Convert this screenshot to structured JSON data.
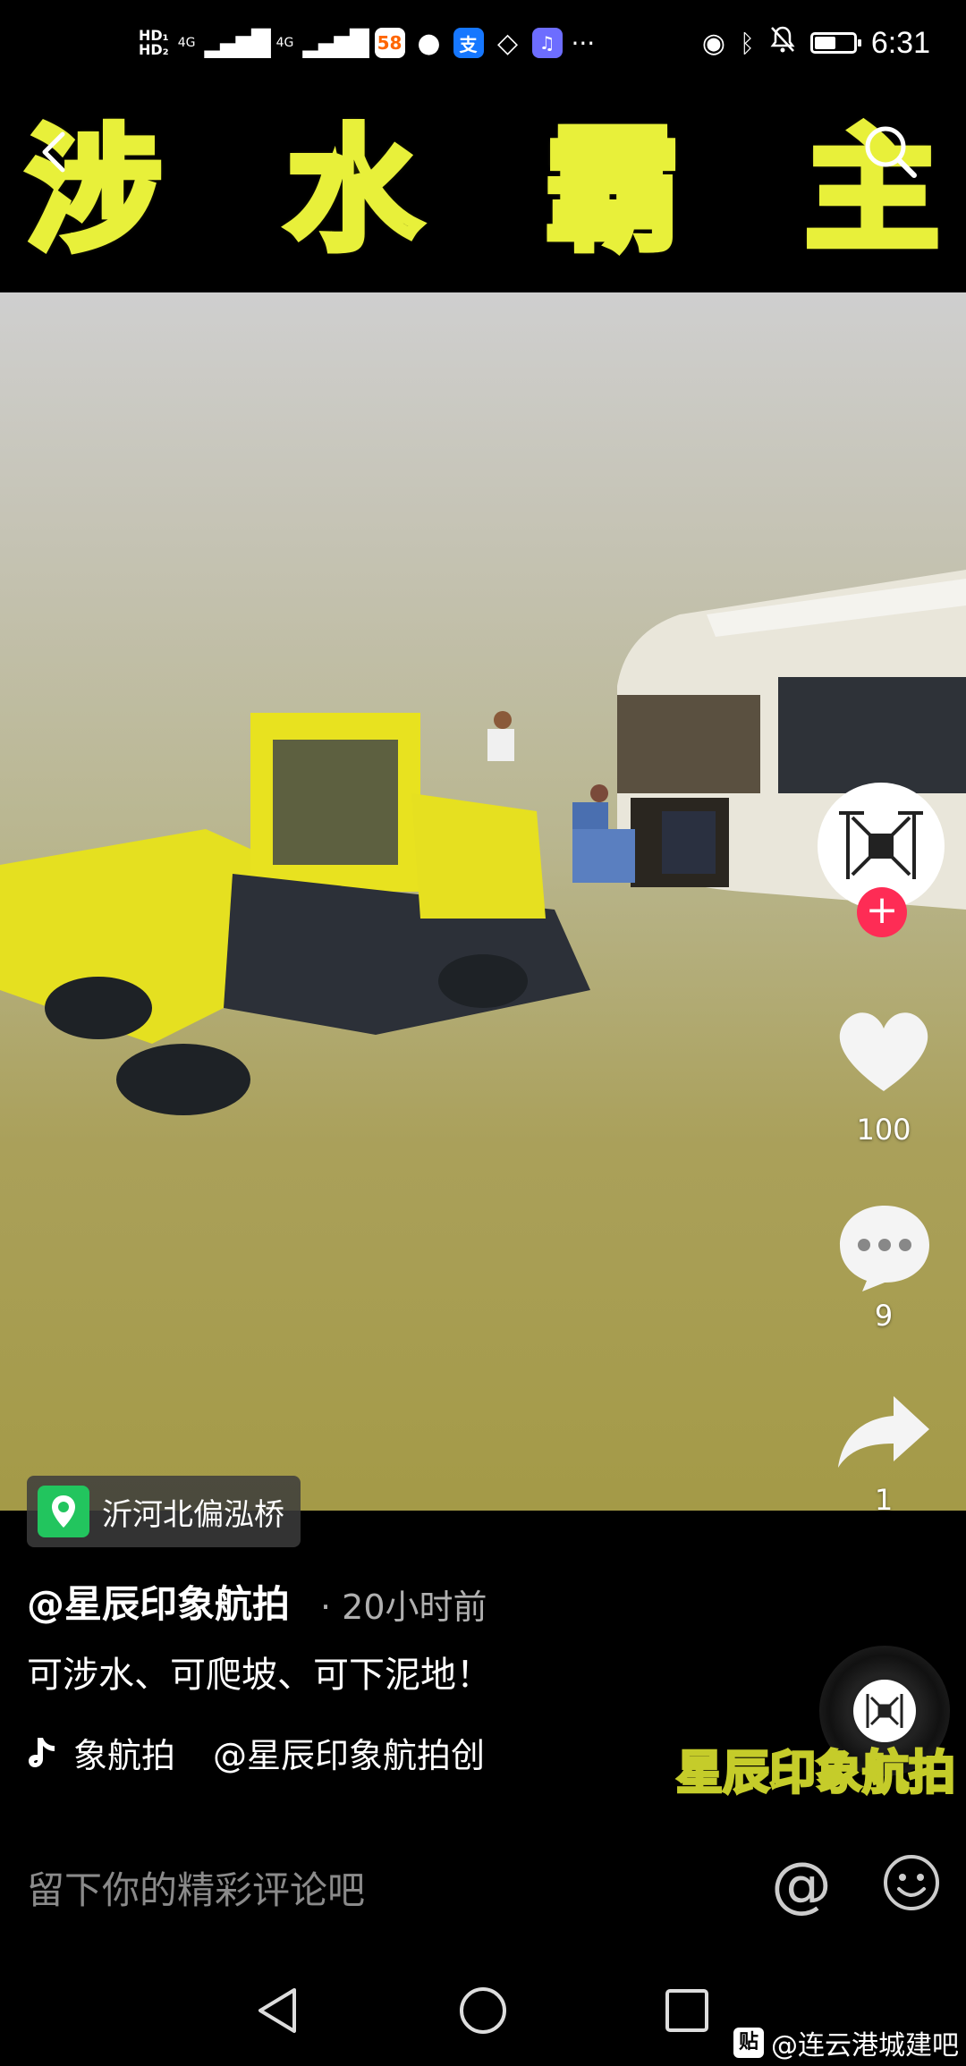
{
  "status_bar": {
    "sim1": "HD₁",
    "sim2": "HD₂",
    "net1": "4G",
    "net2": "4G",
    "app1_label": "58",
    "app3_label": "支",
    "more": "···",
    "time": "6:31",
    "battery_level": 0.55
  },
  "banner": {
    "title_chars": [
      "涉",
      "水",
      "霸",
      "主"
    ]
  },
  "rail": {
    "like_count": "100",
    "comment_count": "9",
    "share_count": "1"
  },
  "location": {
    "name": "沂河北偏泓桥"
  },
  "post": {
    "author": "@星辰印象航拍",
    "time_ago": "· 20小时前",
    "description": "可涉水、可爬坡、可下泥地！",
    "music_text": "象航拍",
    "music_author": "@星辰印象航拍创"
  },
  "watermark": "星辰印象航拍",
  "comment_bar": {
    "placeholder": "留下你的精彩评论吧",
    "at_symbol": "@"
  },
  "nav_credit": {
    "badge": "贴",
    "text": "@连云港城建吧"
  },
  "colors": {
    "banner_yellow": "#e8f03a",
    "follow_red": "#fe2c55",
    "location_green": "#22c55e"
  }
}
